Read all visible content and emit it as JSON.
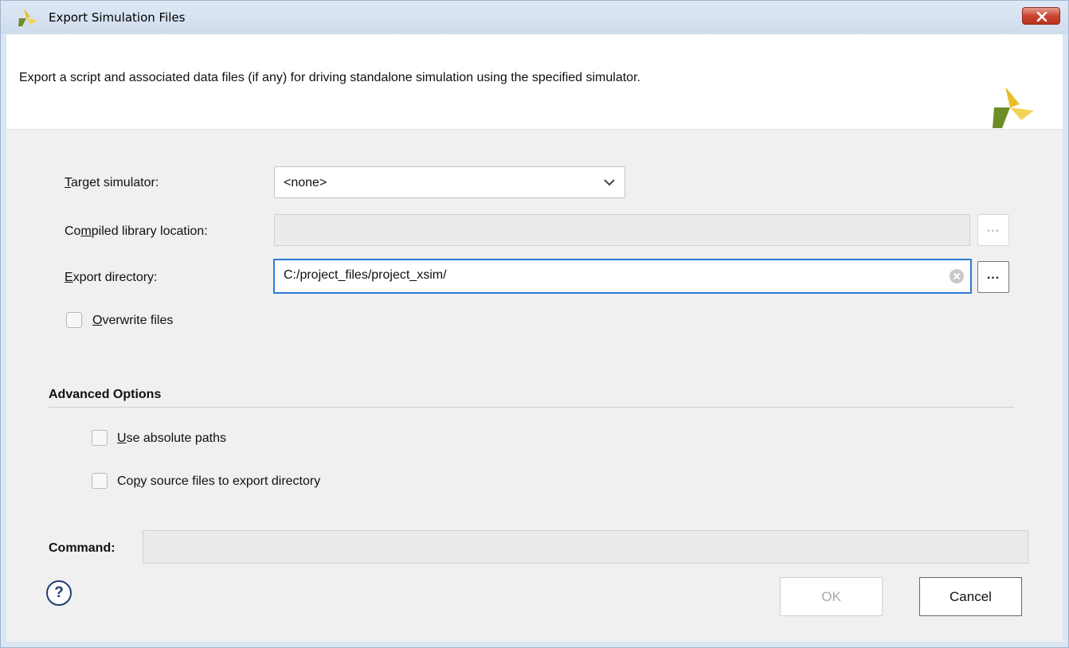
{
  "window": {
    "title": "Export Simulation Files",
    "app_icon": "vivado-logo-icon",
    "close_icon": "close-icon"
  },
  "header": {
    "description": "Export a script and associated data files (if any) for driving standalone simulation using the specified simulator.",
    "logo": "vivado-logo-icon"
  },
  "form": {
    "target_simulator": {
      "label": "Target simulator:",
      "value": "<none>"
    },
    "compiled_library": {
      "label": "Compiled library location:",
      "value": "",
      "browse_label": "...",
      "enabled": false
    },
    "export_directory": {
      "label": "Export directory:",
      "value": "C:/project_files/project_xsim/",
      "browse_label": "...",
      "enabled": true
    },
    "overwrite": {
      "label": "Overwrite files",
      "checked": false
    }
  },
  "advanced": {
    "title": "Advanced Options",
    "use_absolute_paths": {
      "label": "Use absolute paths",
      "checked": false
    },
    "copy_source_files": {
      "label": "Copy source files to export directory",
      "checked": false
    }
  },
  "command": {
    "label": "Command:",
    "value": ""
  },
  "footer": {
    "help_label": "?",
    "ok_label": "OK",
    "ok_enabled": false,
    "cancel_label": "Cancel"
  },
  "colors": {
    "accent_focus": "#2b7ad8",
    "logo_yellow": "#e8bd2a",
    "logo_green": "#6e8c28"
  }
}
